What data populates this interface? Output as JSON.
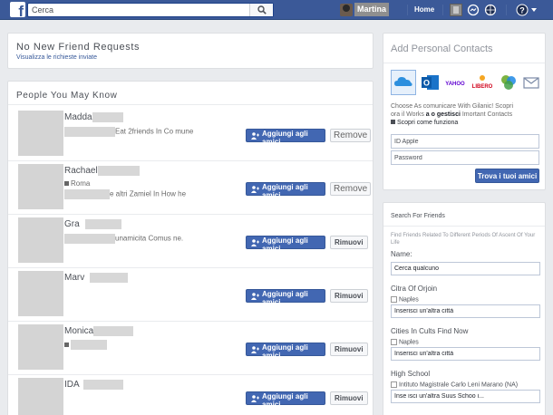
{
  "topbar": {
    "search_placeholder": "Cerca",
    "profile_name": "Martina",
    "home_label": "Home",
    "brand_color": "#3b5998"
  },
  "requests": {
    "title": "No New Friend Requests",
    "view_sent_link": "Visualizza le richieste inviate"
  },
  "pymk": {
    "title": "People You May Know",
    "add_label": "Aggiungi agli amici",
    "people": [
      {
        "name": "Madda",
        "sub1": "Eat 2friends In Co mune",
        "sub2": "",
        "remove": "Remove"
      },
      {
        "name": "Rachael",
        "sub1": "Roma",
        "sub2": "e altri Zamiel In How he",
        "remove": "Remove"
      },
      {
        "name": "Gra",
        "sub1": "unamicita Comus ne.",
        "sub2": "",
        "remove": "Rimuovi"
      },
      {
        "name": "Marv",
        "sub1": "",
        "sub2": "",
        "remove": "Rimuovi"
      },
      {
        "name": "Monica",
        "sub1": "",
        "sub2": "",
        "remove": "Rimuovi"
      },
      {
        "name": "IDA",
        "sub1": "",
        "sub2": "",
        "remove": "Rimuovi"
      }
    ]
  },
  "contacts": {
    "title": "Add Personal Contacts",
    "services": [
      "iCloud",
      "Outlook",
      "YAHOO",
      "LIBERO",
      "Windows Live",
      "Mail"
    ],
    "info_line1": "Choose As comunicare With Gilanic! Scopri",
    "info_line2_a": "ora il Works ",
    "info_line2_b": "a o gestisci",
    "info_line2_c": " Imortant Contacts",
    "info_line3": "Scopri come funziona",
    "apple_id_placeholder": "ID Apple",
    "password_placeholder": "Password",
    "find_button": "Trova i tuoi amici"
  },
  "search_friends": {
    "title": "Search For Friends",
    "desc": "Find Friends Related To Different Periods Of Ascent Of Your Life",
    "name_label": "Name:",
    "name_placeholder": "Cerca qualcuno",
    "origin_label": "Citra Of Orjoin",
    "origin_check": "Naples",
    "origin_placeholder": "Inserisci un'altra città",
    "current_label": "Cities In Cults Find Now",
    "current_check": "Naples",
    "current_placeholder": "Inserisci un'altra città",
    "school_label": "High School",
    "school_check": "Intituto Magistrale Carlo Leni Marano (NA)",
    "school_placeholder": "Inse isci un'altra Suus Schoo i..."
  }
}
